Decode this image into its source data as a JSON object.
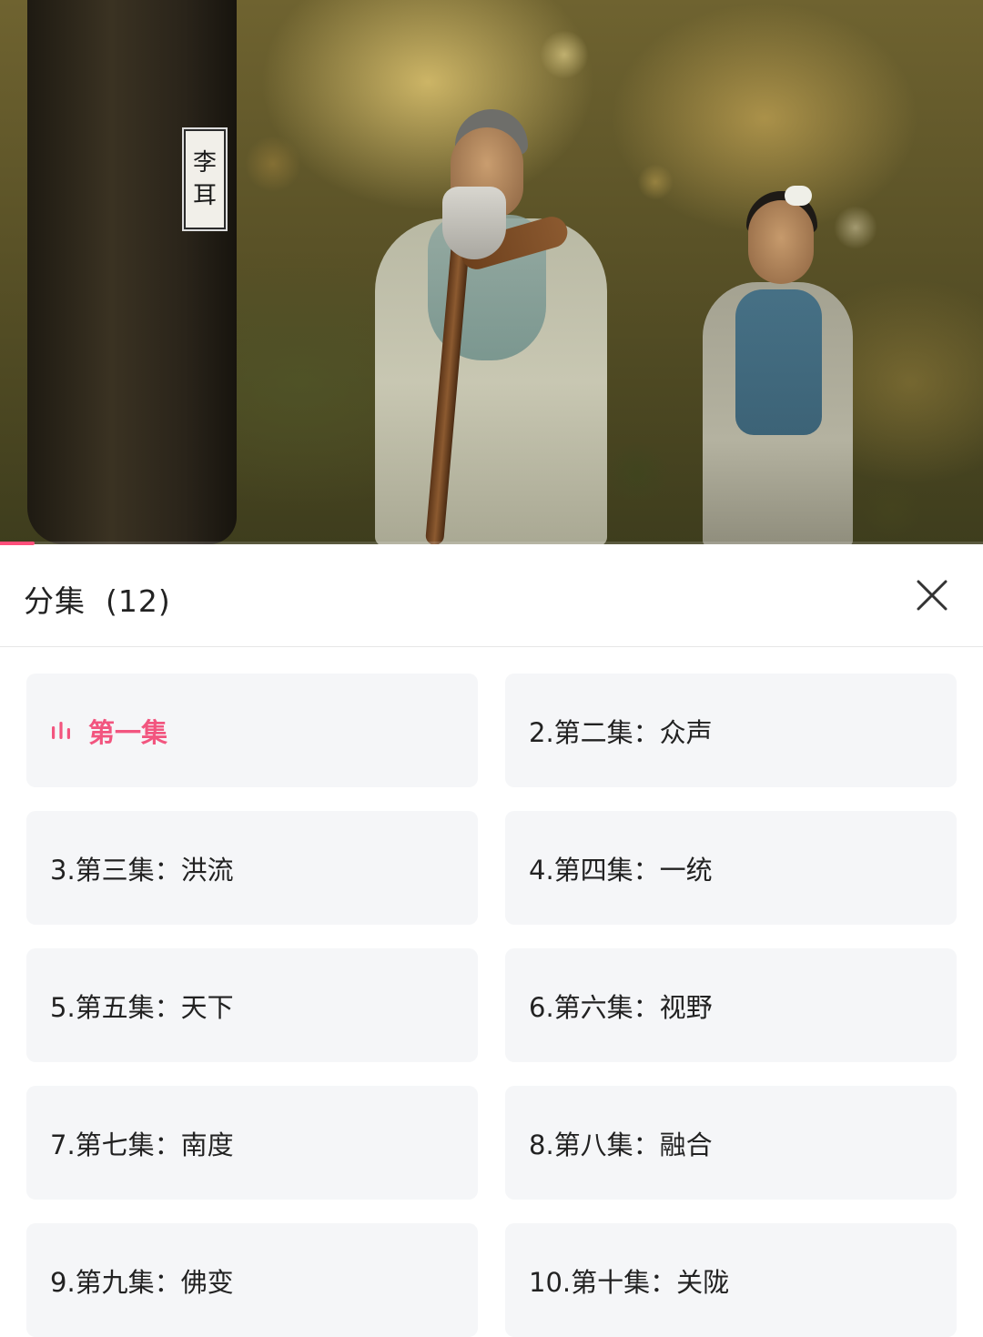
{
  "video": {
    "caption_name": "李耳",
    "caption_chars": [
      "李",
      "耳"
    ],
    "progress": 0.035
  },
  "panel": {
    "title": "分集",
    "count": "(12)",
    "close_icon": "close-icon"
  },
  "episodes": [
    {
      "label": "第一集",
      "active": true,
      "icon": "playing-indicator-icon"
    },
    {
      "label": "2.第二集：众声"
    },
    {
      "label": "3.第三集：洪流"
    },
    {
      "label": "4.第四集：一统"
    },
    {
      "label": "5.第五集：天下"
    },
    {
      "label": "6.第六集：视野"
    },
    {
      "label": "7.第七集：南度"
    },
    {
      "label": "8.第八集：融合"
    },
    {
      "label": "9.第九集：佛变"
    },
    {
      "label": "10.第十集：关陇"
    }
  ],
  "colors": {
    "accent": "#f2557f",
    "tile_bg": "#f5f6f8",
    "text": "#222222"
  }
}
